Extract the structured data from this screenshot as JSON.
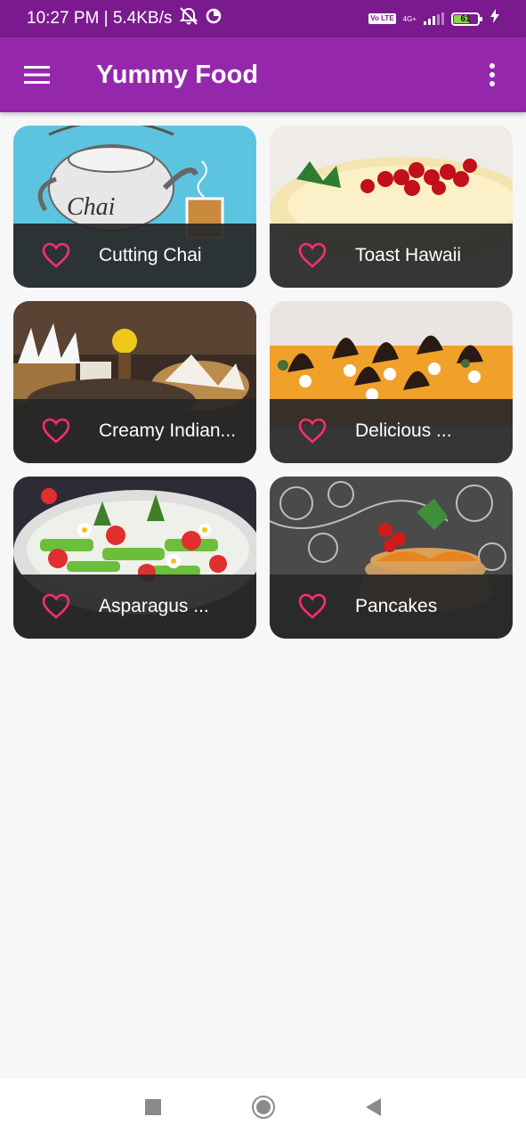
{
  "status_bar": {
    "time": "10:27 PM | 5.4KB/s",
    "volte_label": "Vo LTE",
    "network_label": "4G+",
    "battery_percent": "61",
    "icons": [
      "mute-bell-icon",
      "data-saver-icon",
      "signal-icon",
      "battery-icon",
      "charging-icon"
    ]
  },
  "app_bar": {
    "title": "Yummy Food",
    "menu_icon": "hamburger-menu-icon",
    "overflow_icon": "more-vert-icon"
  },
  "recipes": [
    {
      "name": "Cutting Chai",
      "favorite_icon": "heart-outline-icon"
    },
    {
      "name": "Toast Hawaii",
      "favorite_icon": "heart-outline-icon"
    },
    {
      "name": "Creamy Indian...",
      "favorite_icon": "heart-outline-icon"
    },
    {
      "name": "Delicious ...",
      "favorite_icon": "heart-outline-icon"
    },
    {
      "name": "Asparagus ...",
      "favorite_icon": "heart-outline-icon"
    },
    {
      "name": "Pancakes",
      "favorite_icon": "heart-outline-icon"
    }
  ],
  "colors": {
    "status_bar": "#7b1a8e",
    "app_bar": "#9527ad",
    "heart": "#ff2d6f",
    "overlay": "#282828"
  },
  "nav_bar": {
    "icons": [
      "recents-square-icon",
      "home-circle-icon",
      "back-triangle-icon"
    ]
  }
}
